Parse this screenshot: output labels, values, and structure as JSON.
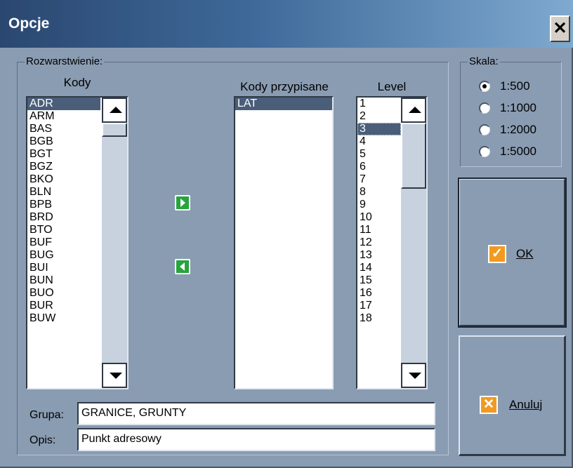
{
  "window": {
    "title": "Opcje",
    "close_glyph": "✕"
  },
  "layers_group": {
    "legend": "Rozwarstwienie:",
    "codes_label": "Kody",
    "assigned_label": "Kody przypisane",
    "level_label": "Level"
  },
  "codes": [
    "ADR",
    "ARM",
    "BAS",
    "BGB",
    "BGT",
    "BGZ",
    "BKO",
    "BLN",
    "BPB",
    "BRD",
    "BTO",
    "BUF",
    "BUG",
    "BUI",
    "BUN",
    "BUO",
    "BUR",
    "BUW"
  ],
  "codes_selected": "ADR",
  "assigned_codes": [
    "LAT"
  ],
  "assigned_selected": "LAT",
  "levels": [
    "1",
    "2",
    "3",
    "4",
    "5",
    "6",
    "7",
    "8",
    "9",
    "10",
    "11",
    "12",
    "13",
    "14",
    "15",
    "16",
    "17",
    "18"
  ],
  "level_selected": "3",
  "move_buttons": {
    "add_icon": "arrow-right-icon",
    "remove_icon": "arrow-left-icon",
    "color": "#27a43c"
  },
  "scale_group": {
    "legend": "Skala:",
    "options": [
      "1:500",
      "1:1000",
      "1:2000",
      "1:5000"
    ],
    "selected": "1:500"
  },
  "buttons": {
    "ok_label": "OK",
    "cancel_label": "Anuluj",
    "ok_icon": "check-icon",
    "cancel_icon": "x-icon",
    "icon_color": "#f29a20"
  },
  "fields": {
    "group_label": "Grupa:",
    "group_value": "GRANICE, GRUNTY",
    "desc_label": "Opis:",
    "desc_value": "Punkt adresowy"
  },
  "colors": {
    "dialog_bg": "#8a9cb2",
    "selection": "#4a5e7a",
    "titlebar": "#2a4770"
  }
}
